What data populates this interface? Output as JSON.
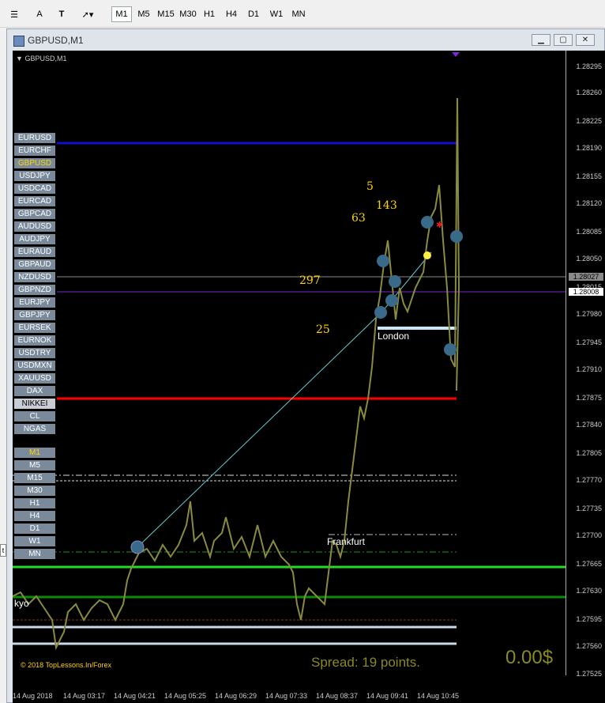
{
  "toolbar": {
    "buttons": [
      "M1",
      "M5",
      "M15",
      "M30",
      "H1",
      "H4",
      "D1",
      "W1",
      "MN"
    ],
    "selected": "M1"
  },
  "window": {
    "title": "GBPUSD,M1"
  },
  "chart": {
    "symbol_label": "GBPUSD,M1",
    "symbols": [
      "EURUSD",
      "EURCHF",
      "GBPUSD",
      "USDJPY",
      "USDCAD",
      "EURCAD",
      "GBPCAD",
      "AUDUSD",
      "AUDJPY",
      "EURAUD",
      "GBPAUD",
      "NZDUSD",
      "GBPNZD",
      "EURJPY",
      "GBPJPY",
      "EURSEK",
      "EURNOK",
      "USDTRY",
      "USDMXN",
      "XAUUSD",
      "DAX",
      "NIKKEI",
      "CL",
      "NGAS"
    ],
    "selected_symbol": "GBPUSD",
    "timeframes": [
      "M1",
      "M5",
      "M15",
      "M30",
      "H1",
      "H4",
      "D1",
      "W1",
      "MN"
    ],
    "selected_timeframe": "M1",
    "price_ticks": [
      "1.28295",
      "1.28260",
      "1.28225",
      "1.28190",
      "1.28155",
      "1.28120",
      "1.28085",
      "1.28050",
      "1.28015",
      "1.27980",
      "1.27945",
      "1.27910",
      "1.27875",
      "1.27840",
      "1.27805",
      "1.27770",
      "1.27735",
      "1.27700",
      "1.27665",
      "1.27630",
      "1.27595",
      "1.27560",
      "1.27525"
    ],
    "price_labels": [
      "1.28027",
      "1.28008"
    ],
    "time_ticks": [
      "14 Aug 2018",
      "14 Aug 03:17",
      "14 Aug 04:21",
      "14 Aug 05:25",
      "14 Aug 06:29",
      "14 Aug 07:33",
      "14 Aug 08:37",
      "14 Aug 09:41",
      "14 Aug 10:45"
    ],
    "numbers": [
      "5",
      "143",
      "63",
      "297",
      "25"
    ],
    "sessions": {
      "london": "London",
      "frankfurt": "Frankfurt",
      "tokyo": "kyo"
    },
    "copyright": "© 2018 TopLessons.In/Forex",
    "spread": "Spread: 19 points.",
    "profit": "0.00$",
    "side_mark": "t",
    "colors": {
      "blue_line": "#1010d0",
      "red_line": "#ff0000",
      "green_line": "#22dd22",
      "dark_green_line": "#0a8a0a",
      "price_line": "#8a8a8a",
      "purple_line": "#7a2ad0",
      "candles": "#8a8a40",
      "trend": "#66cccc",
      "yellow_text": "#ffd400",
      "spread_text": "#8a8a20"
    }
  }
}
